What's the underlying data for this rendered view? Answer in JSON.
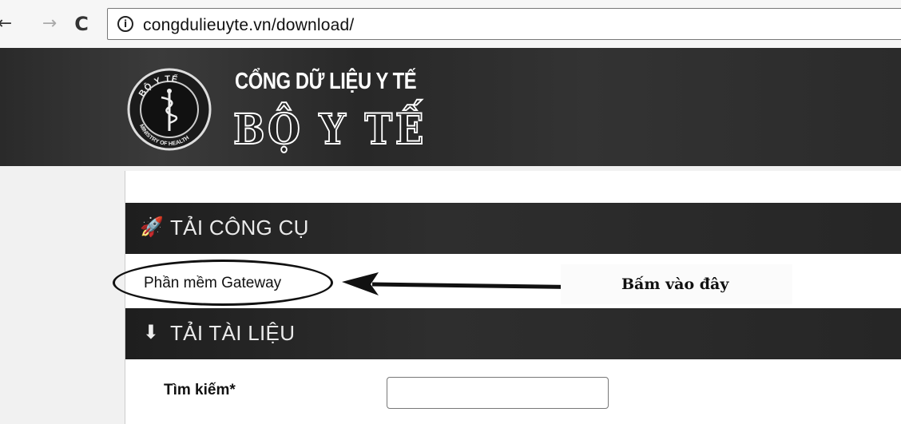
{
  "browser": {
    "back_icon": "arrow-back-icon",
    "back_glyph": "←",
    "forward_icon": "arrow-forward-icon",
    "forward_glyph": "→",
    "reload_icon": "reload-icon",
    "reload_glyph": "C",
    "info_icon": "info-icon",
    "info_glyph": "i",
    "url": "congdulieuyte.vn/download/"
  },
  "header": {
    "portal_title": "CỔNG DỮ LIỆU Y TẾ",
    "ministry_title": "BỘ Y TẾ",
    "logo": {
      "top_text": "BỘ Y TẾ",
      "bottom_text": "MINISTRY OF HEALTH"
    }
  },
  "sections": {
    "tools": {
      "icon": "rocket-icon",
      "glyph": "🚀",
      "label": "TẢI CÔNG CỤ"
    },
    "docs": {
      "icon": "download-icon",
      "glyph": "⬇",
      "label": "TẢI TÀI LIỆU"
    }
  },
  "tools_list": {
    "gateway_link": "Phần mềm Gateway"
  },
  "annotation": {
    "callout": "Bấm vào đây"
  },
  "search": {
    "label": "Tìm kiếm*",
    "value": "",
    "placeholder": ""
  },
  "colors": {
    "header_bg": "#2b2b2b",
    "section_bar_bg": "#262626",
    "panel_bg": "#ffffff"
  }
}
